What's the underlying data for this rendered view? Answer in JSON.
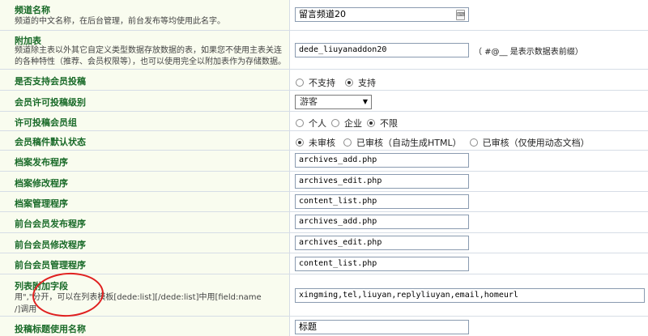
{
  "rows": {
    "channel_name": {
      "label": "频道名称",
      "desc": "频道的中文名称，在后台管理，前台发布等均使用此名字。",
      "value": "留言频道20",
      "ime_icon": "keyboard-icon"
    },
    "addon_table": {
      "label": "附加表",
      "desc_line1": "频道除主表以外其它自定义类型数据存放数据的表，如果您不使用主表关连",
      "desc_line2": "的各种特性（推荐、会员权限等），也可以使用完全以附加表作为存储数据。",
      "value": "dede_liuyanaddon20",
      "hint": "（ #@__ 是表示数据表前缀）"
    },
    "member_submit": {
      "label": "是否支持会员投稿",
      "options": [
        "不支持",
        "支持"
      ],
      "selected": 1
    },
    "member_level": {
      "label": "会员许可投稿级别",
      "value": "游客"
    },
    "member_group": {
      "label": "许可投稿会员组",
      "options": [
        "个人",
        "企业",
        "不限"
      ],
      "selected": 2
    },
    "member_status": {
      "label": "会员稿件默认状态",
      "options": [
        "未审核",
        "已审核（自动生成HTML）",
        "已审核（仅使用动态文档）"
      ],
      "selected": 0
    },
    "add_program": {
      "label": "档案发布程序",
      "value": "archives_add.php"
    },
    "edit_program": {
      "label": "档案修改程序",
      "value": "archives_edit.php"
    },
    "manage_program": {
      "label": "档案管理程序",
      "value": "content_list.php"
    },
    "front_add_program": {
      "label": "前台会员发布程序",
      "value": "archives_add.php"
    },
    "front_edit_program": {
      "label": "前台会员修改程序",
      "value": "archives_edit.php"
    },
    "front_manage_program": {
      "label": "前台会员管理程序",
      "value": "content_list.php"
    },
    "list_fields": {
      "label": "列表附加字段",
      "desc_line1": "用\",\"分开，可以在列表模板[dede:list][/dede:list]中用[field:name",
      "desc_line2": "/]调用",
      "value": "xingming,tel,liuyan,replyliuyan,email,homeurl"
    },
    "title_name": {
      "label": "投稿标题使用名称",
      "value": "标题"
    }
  },
  "colors": {
    "label_green": "#196a28",
    "left_bg": "#f9fcef",
    "border": "#d6dde6",
    "annotation_circle": "#e02020"
  }
}
